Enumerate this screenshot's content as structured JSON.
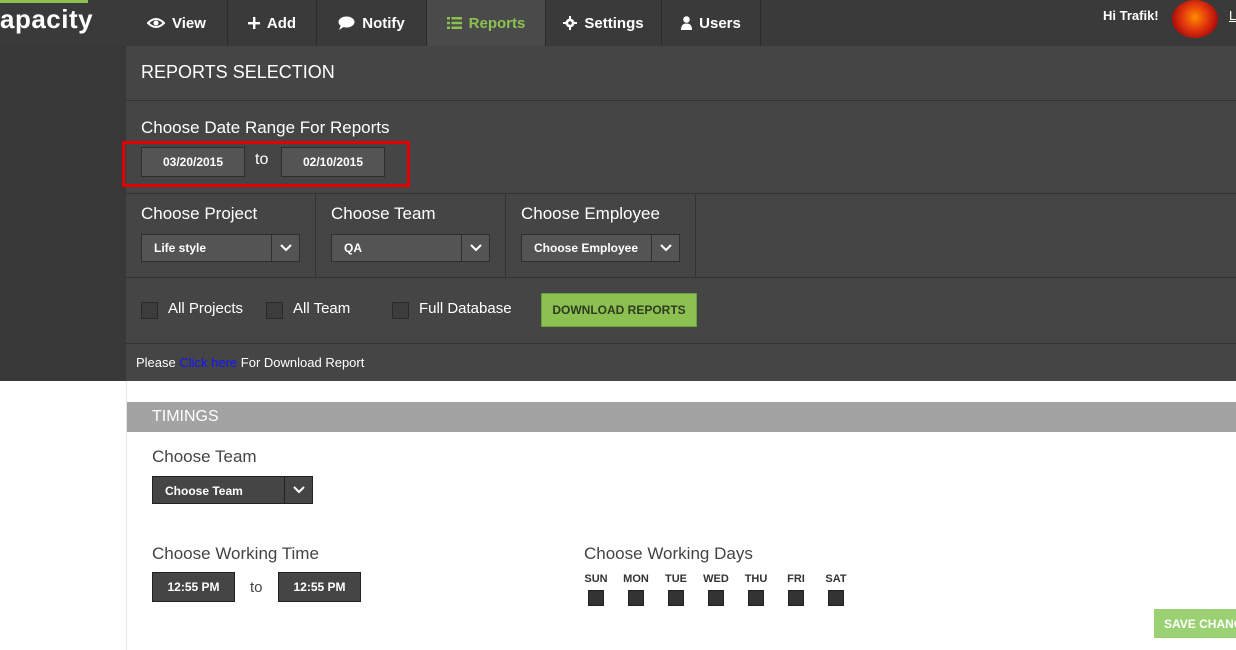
{
  "app": {
    "logo_text": "apacity",
    "accent": "#8cc152"
  },
  "nav": {
    "items": [
      {
        "label": "View",
        "icon": "eye-icon"
      },
      {
        "label": "Add",
        "icon": "plus-icon"
      },
      {
        "label": "Notify",
        "icon": "speech-bubble-icon"
      },
      {
        "label": "Reports",
        "icon": "list-icon",
        "active": true
      },
      {
        "label": "Settings",
        "icon": "gear-icon"
      },
      {
        "label": "Users",
        "icon": "user-icon"
      }
    ]
  },
  "user": {
    "greeting": "Hi Trafik!",
    "logout_partial": "L"
  },
  "reports": {
    "title": "REPORTS SELECTION",
    "date_range_label": "Choose Date Range For Reports",
    "date_from": "03/20/2015",
    "date_to_sep": "to",
    "date_to": "02/10/2015",
    "project_label": "Choose Project",
    "project_value": "Life style",
    "team_label": "Choose Team",
    "team_value": "QA",
    "employee_label": "Choose Employee",
    "employee_value": "Choose Employee",
    "all_projects": "All Projects",
    "all_team": "All Team",
    "full_database": "Full Database",
    "download_button": "DOWNLOAD REPORTS",
    "please_prefix": "Please",
    "click_here": "Click here",
    "please_suffix": "For Download Report"
  },
  "timings": {
    "title": "TIMINGS",
    "team_label": "Choose Team",
    "team_value": "Choose Team",
    "working_time_label": "Choose Working Time",
    "time_from": "12:55 PM",
    "time_sep": "to",
    "time_to": "12:55 PM",
    "working_days_label": "Choose Working Days",
    "days": [
      "SUN",
      "MON",
      "TUE",
      "WED",
      "THU",
      "FRI",
      "SAT"
    ],
    "save_button": "SAVE CHANG"
  }
}
